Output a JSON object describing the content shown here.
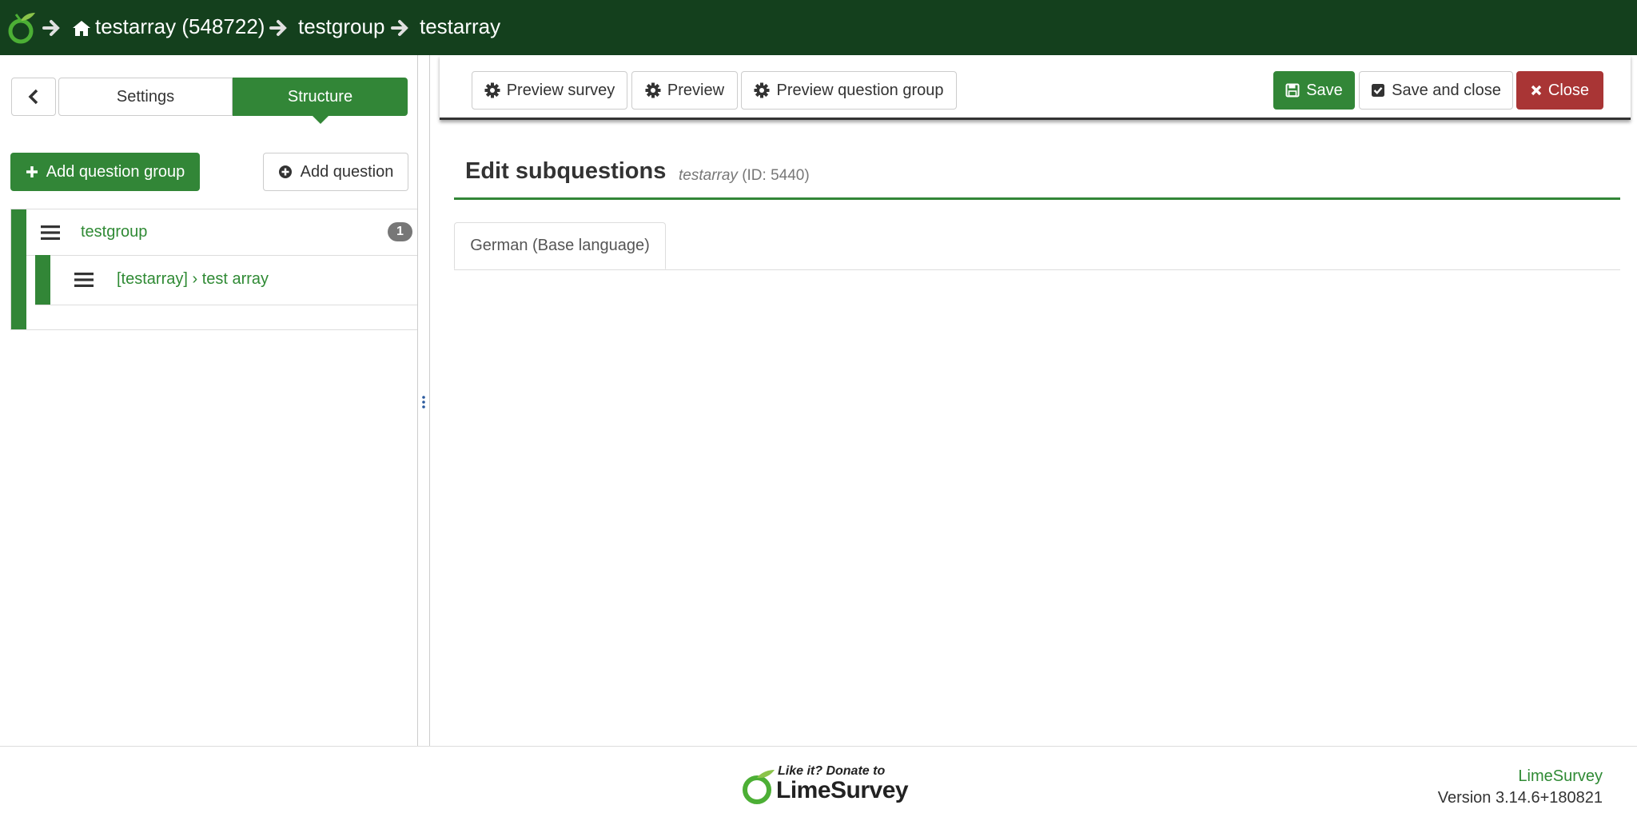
{
  "colors": {
    "topbar": "#14401d",
    "accent_green": "#328637",
    "link_green": "#2f8a34",
    "danger_red": "#a93535",
    "badge_gray": "#777777"
  },
  "topbar": {
    "logo_icon": "limesurvey-logo-icon",
    "breadcrumb": {
      "survey": "testarray (548722)",
      "group": "testgroup",
      "question": "testarray"
    }
  },
  "sidebar": {
    "back_icon": "chevron-left-icon",
    "tabs": {
      "settings": "Settings",
      "structure": "Structure"
    },
    "add_question_group": "Add question group",
    "add_question": "Add question",
    "groups": [
      {
        "name": "testgroup",
        "count": "1",
        "questions": [
          {
            "label": "[testarray] › test array"
          }
        ]
      }
    ]
  },
  "toolbar": {
    "preview_survey": "Preview survey",
    "preview": "Preview",
    "preview_question_group": "Preview question group",
    "save": "Save",
    "save_and_close": "Save and close",
    "close": "Close"
  },
  "main": {
    "title": "Edit subquestions",
    "subtitle_name": "testarray",
    "subtitle_id": "(ID: 5440)",
    "language_tab": "German (Base language)"
  },
  "footer": {
    "donate_line": "Like it? Donate to",
    "donate_brand": "LimeSurvey",
    "link": "LimeSurvey",
    "version": "Version 3.14.6+180821"
  }
}
